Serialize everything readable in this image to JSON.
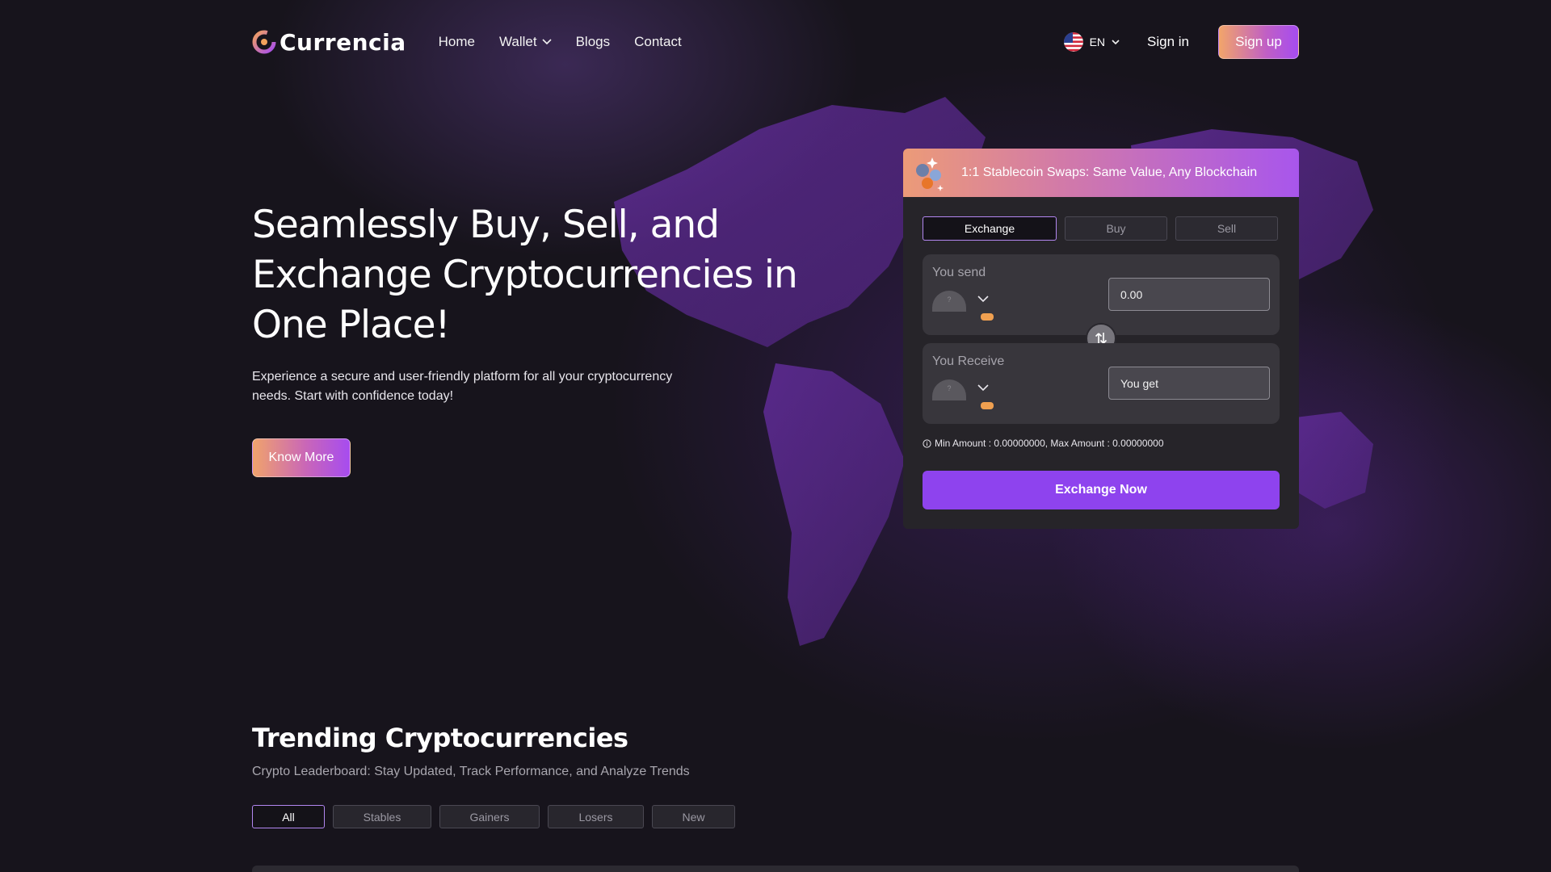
{
  "brand": {
    "name": "Currencia",
    "logo_icon": "currencia-logo-icon"
  },
  "nav": {
    "links": [
      {
        "label": "Home"
      },
      {
        "label": "Wallet",
        "has_dropdown": true
      },
      {
        "label": "Blogs"
      },
      {
        "label": "Contact"
      }
    ],
    "language": {
      "code": "EN",
      "flag_icon": "us-flag-icon"
    },
    "signin_label": "Sign in",
    "signup_label": "Sign up"
  },
  "hero": {
    "title": "Seamlessly Buy, Sell, and Exchange Cryptocurrencies in One Place!",
    "subtitle": "Experience a secure and user-friendly platform for all your cryptocurrency needs. Start with confidence today!",
    "cta_label": "Know More"
  },
  "exchange_widget": {
    "banner_text": "1:1 Stablecoin Swaps: Same Value, Any Blockchain",
    "tabs": [
      {
        "label": "Exchange",
        "active": true
      },
      {
        "label": "Buy",
        "active": false
      },
      {
        "label": "Sell",
        "active": false
      }
    ],
    "send": {
      "label": "You send",
      "value": "0.00",
      "coin_placeholder": "?"
    },
    "receive": {
      "label": "You Receive",
      "placeholder": "You get",
      "coin_placeholder": "?"
    },
    "limits_text": "Min Amount : 0.00000000, Max Amount : 0.00000000",
    "submit_label": "Exchange Now"
  },
  "trending": {
    "title": "Trending Cryptocurrencies",
    "subtitle": "Crypto Leaderboard: Stay Updated, Track Performance, and Analyze Trends",
    "filters": [
      {
        "label": "All",
        "active": true
      },
      {
        "label": "Stables",
        "active": false
      },
      {
        "label": "Gainers",
        "active": false
      },
      {
        "label": "Losers",
        "active": false
      },
      {
        "label": "New",
        "active": false
      }
    ]
  },
  "colors": {
    "background": "#17141c",
    "accent_purple": "#8e43ee",
    "accent_orange": "#f0a36c",
    "active_border": "#b287f0"
  }
}
